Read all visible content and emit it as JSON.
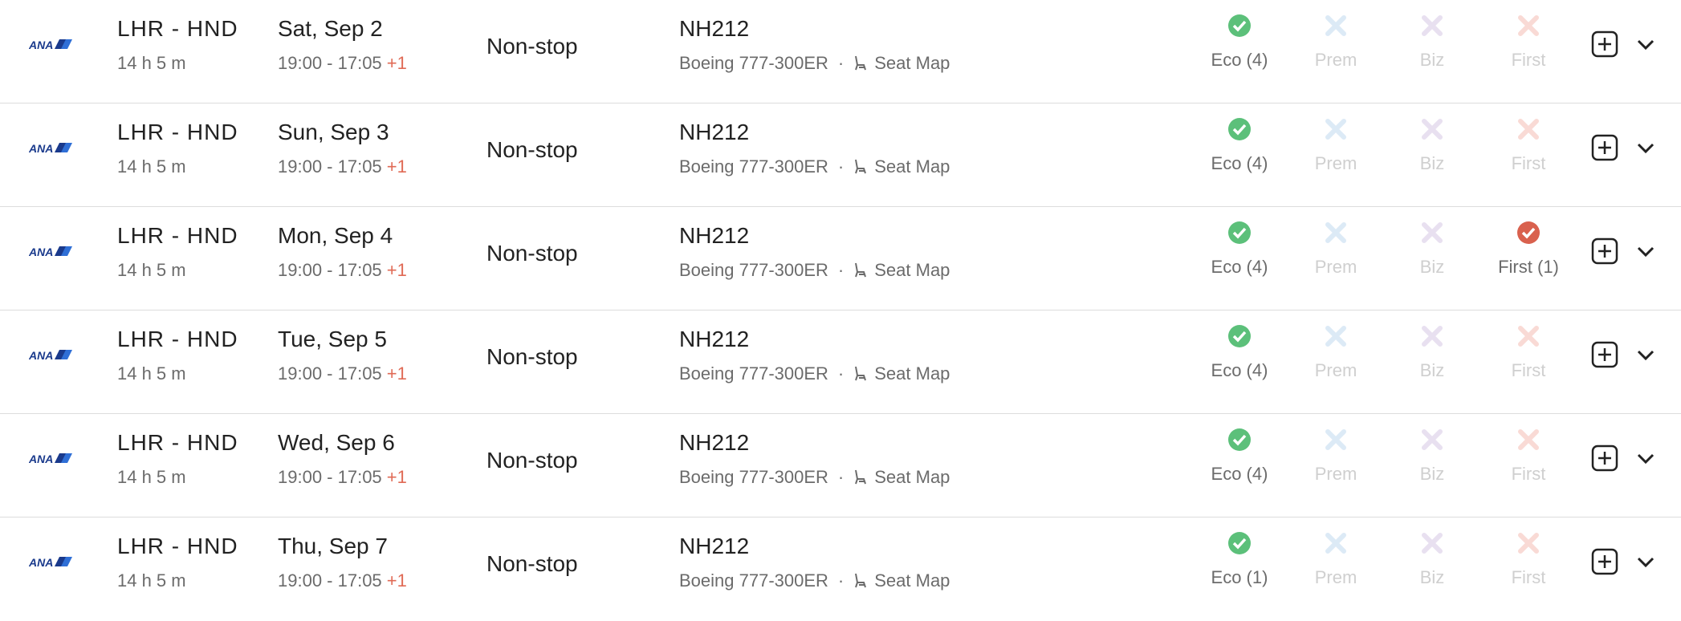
{
  "colors": {
    "available_green": "#5cc07a",
    "first_red": "#d9614e",
    "prem_na": "#dceaf6",
    "biz_na": "#e8e0f0",
    "first_na": "#f9dad5"
  },
  "rows": [
    {
      "airline": "ANA",
      "route": "LHR - HND",
      "duration": "14 h 5 m",
      "date": "Sat, Sep 2",
      "time": "19:00 - 17:05",
      "day_offset": "+1",
      "stops": "Non-stop",
      "flight": "NH212",
      "aircraft": "Boeing 777-300ER",
      "seat_map": "Seat Map",
      "cabins": [
        {
          "label": "Eco (4)",
          "available": true
        },
        {
          "label": "Prem",
          "available": false
        },
        {
          "label": "Biz",
          "available": false
        },
        {
          "label": "First",
          "available": false
        }
      ]
    },
    {
      "airline": "ANA",
      "route": "LHR - HND",
      "duration": "14 h 5 m",
      "date": "Sun, Sep 3",
      "time": "19:00 - 17:05",
      "day_offset": "+1",
      "stops": "Non-stop",
      "flight": "NH212",
      "aircraft": "Boeing 777-300ER",
      "seat_map": "Seat Map",
      "cabins": [
        {
          "label": "Eco (4)",
          "available": true
        },
        {
          "label": "Prem",
          "available": false
        },
        {
          "label": "Biz",
          "available": false
        },
        {
          "label": "First",
          "available": false
        }
      ]
    },
    {
      "airline": "ANA",
      "route": "LHR - HND",
      "duration": "14 h 5 m",
      "date": "Mon, Sep 4",
      "time": "19:00 - 17:05",
      "day_offset": "+1",
      "stops": "Non-stop",
      "flight": "NH212",
      "aircraft": "Boeing 777-300ER",
      "seat_map": "Seat Map",
      "cabins": [
        {
          "label": "Eco (4)",
          "available": true
        },
        {
          "label": "Prem",
          "available": false
        },
        {
          "label": "Biz",
          "available": false
        },
        {
          "label": "First (1)",
          "available": true
        }
      ]
    },
    {
      "airline": "ANA",
      "route": "LHR - HND",
      "duration": "14 h 5 m",
      "date": "Tue, Sep 5",
      "time": "19:00 - 17:05",
      "day_offset": "+1",
      "stops": "Non-stop",
      "flight": "NH212",
      "aircraft": "Boeing 777-300ER",
      "seat_map": "Seat Map",
      "cabins": [
        {
          "label": "Eco (4)",
          "available": true
        },
        {
          "label": "Prem",
          "available": false
        },
        {
          "label": "Biz",
          "available": false
        },
        {
          "label": "First",
          "available": false
        }
      ]
    },
    {
      "airline": "ANA",
      "route": "LHR - HND",
      "duration": "14 h 5 m",
      "date": "Wed, Sep 6",
      "time": "19:00 - 17:05",
      "day_offset": "+1",
      "stops": "Non-stop",
      "flight": "NH212",
      "aircraft": "Boeing 777-300ER",
      "seat_map": "Seat Map",
      "cabins": [
        {
          "label": "Eco (4)",
          "available": true
        },
        {
          "label": "Prem",
          "available": false
        },
        {
          "label": "Biz",
          "available": false
        },
        {
          "label": "First",
          "available": false
        }
      ]
    },
    {
      "airline": "ANA",
      "route": "LHR - HND",
      "duration": "14 h 5 m",
      "date": "Thu, Sep 7",
      "time": "19:00 - 17:05",
      "day_offset": "+1",
      "stops": "Non-stop",
      "flight": "NH212",
      "aircraft": "Boeing 777-300ER",
      "seat_map": "Seat Map",
      "cabins": [
        {
          "label": "Eco (1)",
          "available": true
        },
        {
          "label": "Prem",
          "available": false
        },
        {
          "label": "Biz",
          "available": false
        },
        {
          "label": "First",
          "available": false
        }
      ]
    }
  ]
}
